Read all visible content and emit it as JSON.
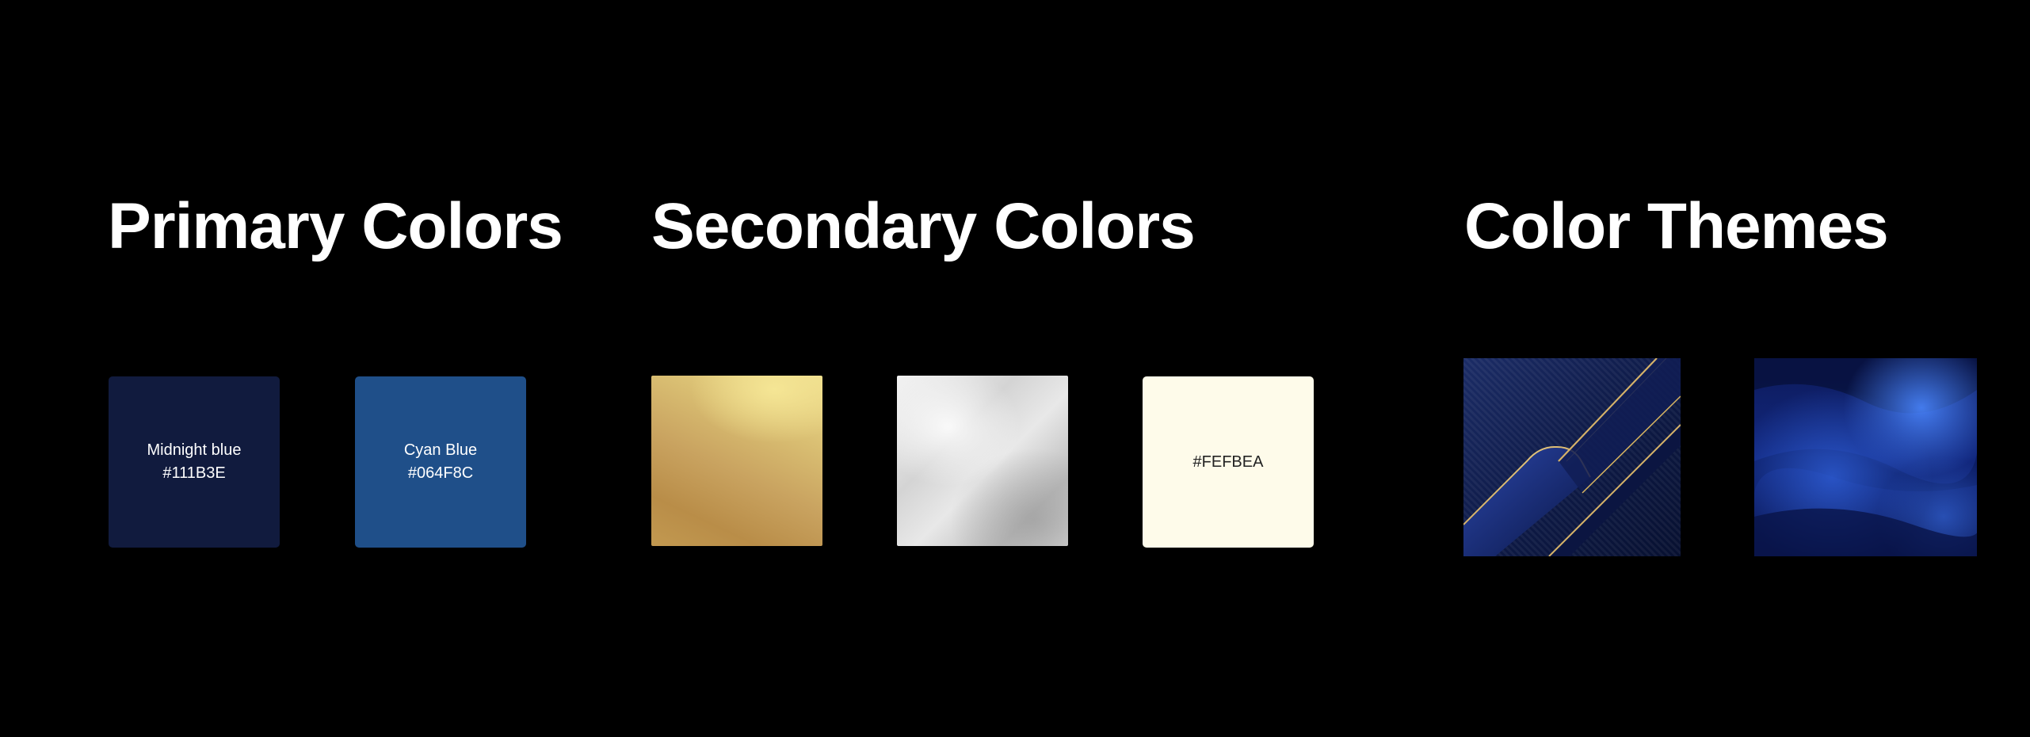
{
  "sections": {
    "primary": {
      "title": "Primary Colors",
      "swatches": [
        {
          "name": "Midnight blue",
          "hex": "#111B3E"
        },
        {
          "name": "Cyan Blue",
          "hex": "#064F8C"
        }
      ]
    },
    "secondary": {
      "title": "Secondary Colors",
      "swatches": [
        {
          "texture": "gold"
        },
        {
          "texture": "silver"
        },
        {
          "hex": "#FEFBEA"
        }
      ]
    },
    "themes": {
      "title": "Color Themes",
      "images": [
        {
          "description": "navy-gold-diagonal-texture"
        },
        {
          "description": "blue-silk-texture"
        }
      ]
    }
  }
}
